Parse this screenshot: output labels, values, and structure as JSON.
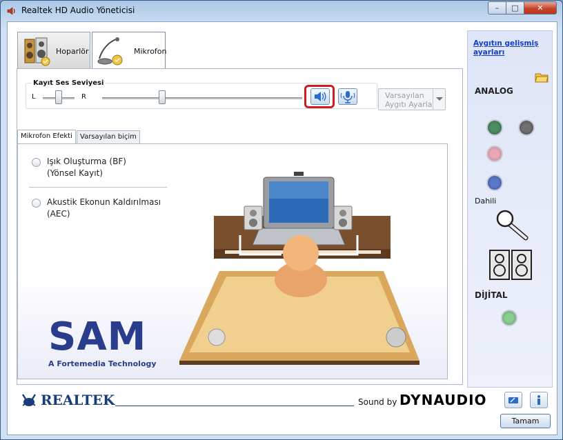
{
  "window": {
    "title": "Realtek HD Audio Yöneticisi"
  },
  "tabs": [
    {
      "label": "Hoparlör"
    },
    {
      "label": "Mikrofon"
    }
  ],
  "recording_volume": {
    "title": "Kayıt Ses Seviyesi",
    "left_label": "L",
    "right_label": "R",
    "balance_level": 0.5,
    "volume_level": 0.3
  },
  "default_device_button": {
    "line1": "Varsayılan",
    "line2": "Aygıtı Ayarla"
  },
  "inner_tabs": [
    {
      "label": "Mikrofon Efekti"
    },
    {
      "label": "Varsayılan biçim"
    }
  ],
  "effects": [
    {
      "line1": "Işık Oluşturma (BF)",
      "line2": "(Yönsel Kayıt)"
    },
    {
      "line1": "Akustik Ekonun Kaldırılması",
      "line2": "(AEC)"
    }
  ],
  "sam_logo": {
    "text": "SAM",
    "tagline": "A Fortemedia Technology"
  },
  "sidebar": {
    "advanced_link_line1": "Aygıtın gelişmiş",
    "advanced_link_line2": "ayarları",
    "analog_label": "ANALOG",
    "internal_label": "Dahili",
    "digital_label": "DİJİTAL"
  },
  "footer": {
    "realtek_logo": "REALTEK",
    "sound_by": "Sound by",
    "dynaudio_logo": "DYNAUDIO",
    "ok_button": "Tamam"
  },
  "colors": {
    "highlight": "#d21a22",
    "link": "#1340c8",
    "sam_blue": "#2a3c8c",
    "sam_pink": "#e0357a"
  }
}
